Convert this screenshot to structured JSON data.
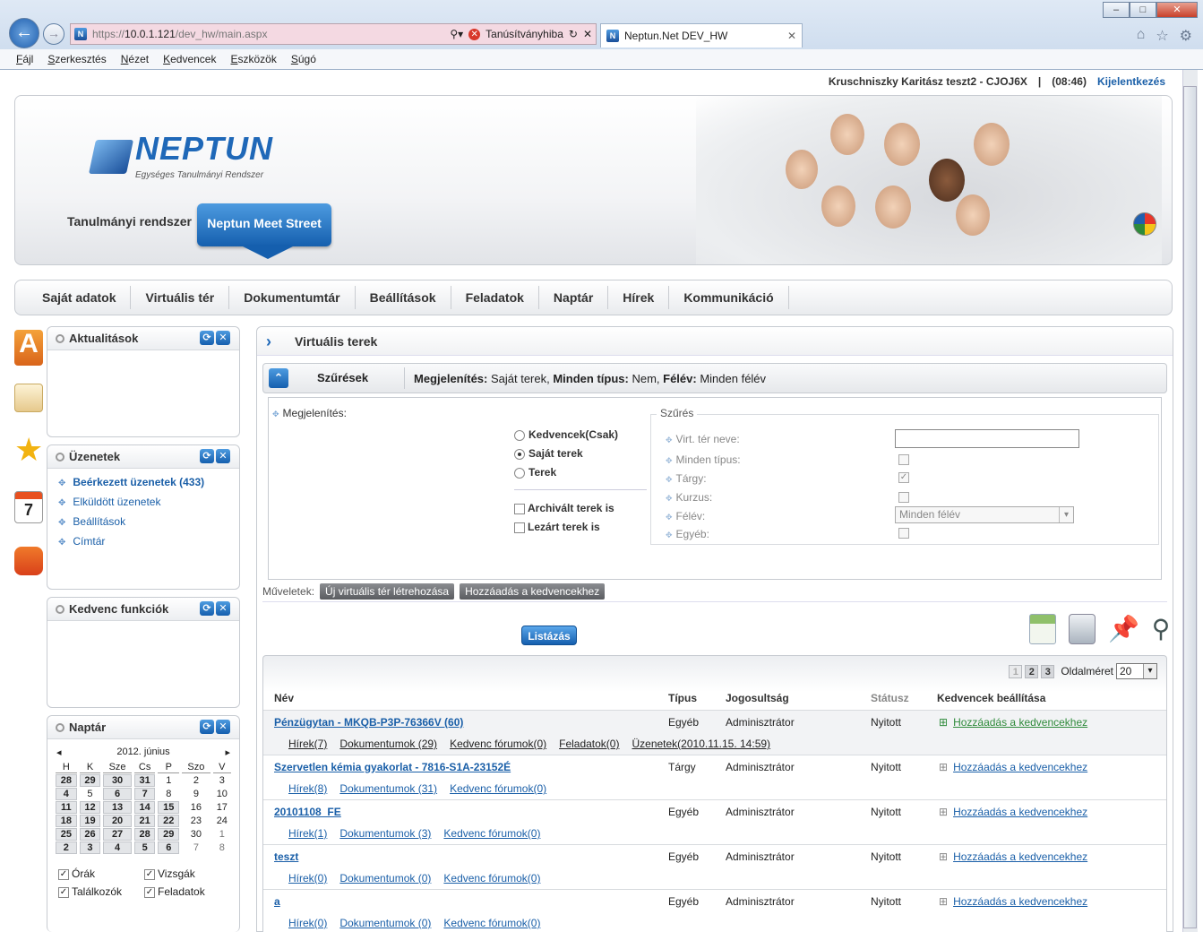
{
  "browser": {
    "url_prefix": "https://",
    "url_host": "10.0.1.121",
    "url_path": "/dev_hw/main.aspx",
    "cert_error": "Tanúsítványhiba",
    "tab_title": "Neptun.Net DEV_HW",
    "menu": [
      "Fájl",
      "Szerkesztés",
      "Nézet",
      "Kedvencek",
      "Eszközök",
      "Súgó"
    ]
  },
  "user": {
    "name": "Kruschniszky Karitász teszt2 - CJOJ6X",
    "sep": "|",
    "time": "(08:46)",
    "logout": "Kijelentkezés"
  },
  "header": {
    "logo_word": "NEPTUN",
    "logo_sub": "Egységes Tanulmányi Rendszer",
    "logo_mark": "N",
    "tab_tanulmanyi": "Tanulmányi rendszer",
    "tab_meet": "Neptun Meet Street"
  },
  "nav": [
    "Saját adatok",
    "Virtuális tér",
    "Dokumentumtár",
    "Beállítások",
    "Feladatok",
    "Naptár",
    "Hírek",
    "Kommunikáció"
  ],
  "side_icons": [
    "news-icon",
    "envelope-icon",
    "star-icon",
    "calendar-icon",
    "chat-icon"
  ],
  "widgets": {
    "aktualitasok": "Aktualitások",
    "uzenetek": {
      "title": "Üzenetek",
      "items": [
        "Beérkezett üzenetek (433)",
        "Elküldött üzenetek",
        "Beállítások",
        "Címtár"
      ]
    },
    "kedvenc": "Kedvenc funkciók",
    "naptar": {
      "title": "Naptár",
      "month": "2012. június",
      "days": [
        "H",
        "K",
        "Sze",
        "Cs",
        "P",
        "Szo",
        "V"
      ],
      "weeks": [
        [
          "28",
          "29",
          "30",
          "31",
          "1",
          "2",
          "3"
        ],
        [
          "4",
          "5",
          "6",
          "7",
          "8",
          "9",
          "10"
        ],
        [
          "11",
          "12",
          "13",
          "14",
          "15",
          "16",
          "17"
        ],
        [
          "18",
          "19",
          "20",
          "21",
          "22",
          "23",
          "24"
        ],
        [
          "25",
          "26",
          "27",
          "28",
          "29",
          "30",
          "1"
        ],
        [
          "2",
          "3",
          "4",
          "5",
          "6",
          "7",
          "8"
        ]
      ],
      "checks": [
        "Órák",
        "Vizsgák",
        "Találkozók",
        "Feladatok"
      ]
    }
  },
  "main": {
    "title": "Virtuális terek",
    "filter_title": "Szűrések",
    "filter_summary_b1": "Megjelenítés:",
    "filter_summary_v1": " Saját terek, ",
    "filter_summary_b2": "Minden típus:",
    "filter_summary_v2": " Nem, ",
    "filter_summary_b3": "Félév:",
    "filter_summary_v3": " Minden félév",
    "megjelenites": "Megjelenítés:",
    "radios": [
      "Kedvencek(Csak)",
      "Saját terek",
      "Terek"
    ],
    "radio_selected": 1,
    "checks": [
      "Archivált terek is",
      "Lezárt terek is"
    ],
    "szures_legend": "Szűrés",
    "szures": {
      "nev": "Virt. tér neve:",
      "tipus": "Minden típus:",
      "targy": "Tárgy:",
      "kurzus": "Kurzus:",
      "felev": "Félév:",
      "felev_value": "Minden félév",
      "egyeb": "Egyéb:"
    },
    "list_button": "Listázás",
    "muveletek": "Műveletek:",
    "btn_new": "Új virtuális tér létrehozása",
    "btn_fav": "Hozzáadás a kedvencekhez",
    "tools": [
      "excel-icon",
      "print-icon",
      "pin-icon",
      "search-icon"
    ]
  },
  "grid": {
    "pages": [
      "1",
      "2",
      "3"
    ],
    "page_size_label": "Oldalméret",
    "page_size": "20",
    "headers": [
      "Név",
      "Típus",
      "Jogosultság",
      "Státusz",
      "Kedvencek beállítása"
    ],
    "rows": [
      {
        "name": "Pénzügytan - MKQB-P3P-76366V (60)",
        "type": "Egyéb",
        "perm": "Adminisztrátor",
        "status": "Nyitott",
        "fav": "Hozzáadás a kedvencekhez",
        "links": [
          "Hírek(7)",
          "Dokumentumok (29)",
          "Kedvenc fórumok(0)",
          "Feladatok(0)",
          "Üzenetek(2010.11.15. 14:59)"
        ]
      },
      {
        "name": "Szervetlen kémia gyakorlat - 7816-S1A-23152É",
        "type": "Tárgy",
        "perm": "Adminisztrátor",
        "status": "Nyitott",
        "fav": "Hozzáadás a kedvencekhez",
        "links": [
          "Hírek(8)",
          "Dokumentumok (31)",
          "Kedvenc fórumok(0)"
        ]
      },
      {
        "name": "20101108_FE",
        "type": "Egyéb",
        "perm": "Adminisztrátor",
        "status": "Nyitott",
        "fav": "Hozzáadás a kedvencekhez",
        "links": [
          "Hírek(1)",
          "Dokumentumok (3)",
          "Kedvenc fórumok(0)"
        ]
      },
      {
        "name": "teszt",
        "type": "Egyéb",
        "perm": "Adminisztrátor",
        "status": "Nyitott",
        "fav": "Hozzáadás a kedvencekhez",
        "links": [
          "Hírek(0)",
          "Dokumentumok (0)",
          "Kedvenc fórumok(0)"
        ]
      },
      {
        "name": "a",
        "type": "Egyéb",
        "perm": "Adminisztrátor",
        "status": "Nyitott",
        "fav": "Hozzáadás a kedvencekhez",
        "links": [
          "Hírek(0)",
          "Dokumentumok (0)",
          "Kedvenc fórumok(0)"
        ]
      }
    ]
  }
}
